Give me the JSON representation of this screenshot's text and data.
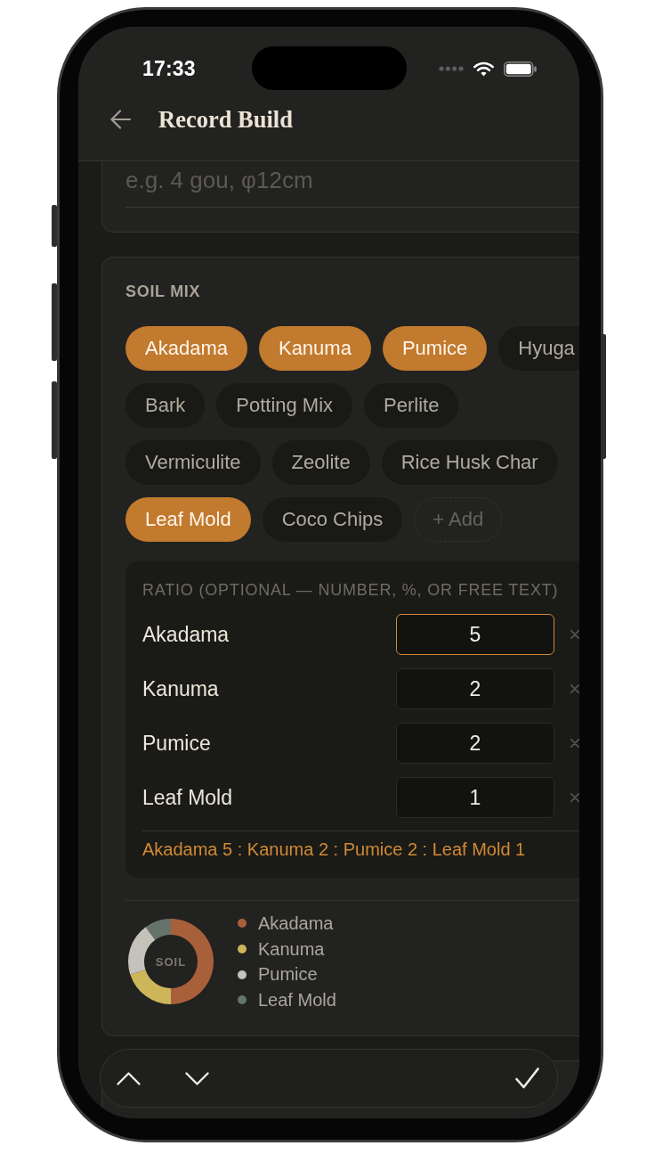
{
  "status_bar": {
    "time": "17:33"
  },
  "header": {
    "title": "Record Build"
  },
  "partial_card": {
    "field": {
      "placeholder": "e.g. 4 gou, φ12cm"
    }
  },
  "soil_mix": {
    "title": "SOIL MIX",
    "chips": [
      {
        "label": "Akadama",
        "selected": true
      },
      {
        "label": "Kanuma",
        "selected": true
      },
      {
        "label": "Pumice",
        "selected": true
      },
      {
        "label": "Hyuga",
        "selected": false
      },
      {
        "label": "Bark",
        "selected": false
      },
      {
        "label": "Potting Mix",
        "selected": false
      },
      {
        "label": "Perlite",
        "selected": false
      },
      {
        "label": "Vermiculite",
        "selected": false
      },
      {
        "label": "Zeolite",
        "selected": false
      },
      {
        "label": "Rice Husk Char",
        "selected": false
      },
      {
        "label": "Leaf Mold",
        "selected": true
      },
      {
        "label": "Coco Chips",
        "selected": false
      }
    ],
    "add_button": {
      "label": "+ Add"
    },
    "ratio": {
      "label": "RATIO (OPTIONAL — NUMBER, %, OR FREE TEXT)",
      "rows": [
        {
          "name": "Akadama",
          "value": "5",
          "focused": true
        },
        {
          "name": "Kanuma",
          "value": "2",
          "focused": false
        },
        {
          "name": "Pumice",
          "value": "2",
          "focused": false
        },
        {
          "name": "Leaf Mold",
          "value": "1",
          "focused": false
        }
      ],
      "summary": "Akadama 5 : Kanuma 2 : Pumice 2 : Leaf Mold 1"
    },
    "chart": {
      "chart_data": {
        "type": "donut",
        "title": "SOIL",
        "categories": [
          "Akadama",
          "Kanuma",
          "Pumice",
          "Leaf Mold"
        ],
        "values": [
          50,
          20,
          20,
          10
        ],
        "legend": "right"
      },
      "legend_entries": [
        {
          "color": "#a8603a"
        },
        {
          "color": "#cdb55a"
        },
        {
          "color": "#c4c2ba"
        },
        {
          "color": "#65736a"
        }
      ]
    }
  }
}
